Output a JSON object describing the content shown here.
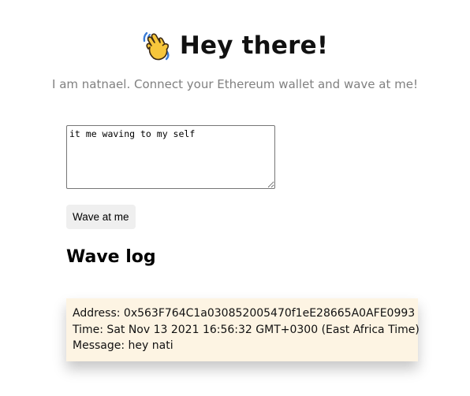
{
  "header": {
    "emoji": "waving-hand-icon",
    "title": "Hey there!"
  },
  "bio": "I am natnael. Connect your Ethereum wallet and wave at me!",
  "message_input": {
    "value": "it me waving to my self"
  },
  "wave_button_label": "Wave at me",
  "wave_log": {
    "heading": "Wave log",
    "entries": [
      {
        "address": "Address: 0x563F764C1a030852005470f1eE28665A0AFE0993",
        "time": "Time: Sat Nov 13 2021 16:56:32 GMT+0300 (East Africa Time)",
        "message": "Message: hey nati"
      }
    ]
  },
  "colors": {
    "card_background": "#fdf4e3",
    "button_background": "#efefef",
    "subtitle_text": "#808080",
    "emoji_yellow": "#f7c63b"
  }
}
